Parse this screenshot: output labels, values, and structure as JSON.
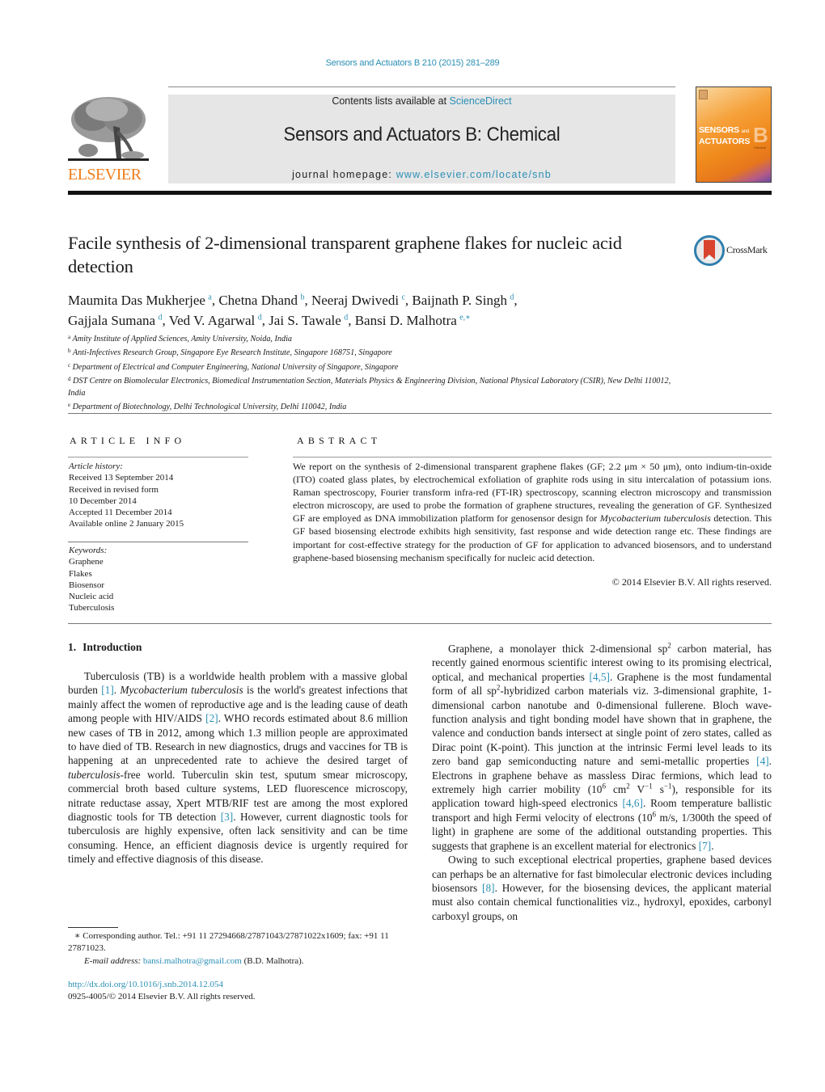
{
  "header": {
    "journal_ref": "Sensors and Actuators B 210 (2015) 281–289",
    "contents_prefix": "Contents lists available at ",
    "contents_link": "ScienceDirect",
    "journal_title": "Sensors and Actuators B: Chemical",
    "homepage_prefix": "journal homepage: ",
    "homepage_link": "www.elsevier.com/locate/snb",
    "publisher_logo_text": "ELSEVIER",
    "cover": {
      "title_line1": "SENSORS",
      "title_and": "and",
      "title_line2": "ACTUATORS",
      "letter": "B",
      "subtitle": "Chemical"
    },
    "colors": {
      "link": "#2b8fb4",
      "elsevier_orange": "#f07d1a",
      "masthead_bg": "#e6e6e6"
    }
  },
  "article": {
    "title": "Facile synthesis of 2-dimensional transparent graphene flakes for nucleic acid detection",
    "crossmark_label": "CrossMark",
    "authors": [
      {
        "name": "Maumita Das Mukherjee",
        "affil": "a",
        "sep": ", "
      },
      {
        "name": "Chetna Dhand",
        "affil": "b",
        "sep": ", "
      },
      {
        "name": "Neeraj Dwivedi",
        "affil": "c",
        "sep": ", "
      },
      {
        "name": "Baijnath P. Singh",
        "affil": "d",
        "sep": ","
      },
      {
        "name": "Gajjala Sumana",
        "affil": "d",
        "sep": ", "
      },
      {
        "name": "Ved V. Agarwal",
        "affil": "d",
        "sep": ", "
      },
      {
        "name": "Jai S. Tawale",
        "affil": "d",
        "sep": ", "
      },
      {
        "name": "Bansi D. Malhotra",
        "affil": "e,∗",
        "sep": ""
      }
    ],
    "affiliations": [
      {
        "key": "a",
        "text": "Amity Institute of Applied Sciences, Amity University, Noida, India"
      },
      {
        "key": "b",
        "text": "Anti-Infectives Research Group, Singapore Eye Research Institute, Singapore 168751, Singapore"
      },
      {
        "key": "c",
        "text": "Department of Electrical and Computer Engineering, National University of Singapore, Singapore"
      },
      {
        "key": "d",
        "text": "DST Centre on Biomolecular Electronics, Biomedical Instrumentation Section, Materials Physics & Engineering Division, National Physical Laboratory (CSIR), New Delhi 110012, India"
      },
      {
        "key": "e",
        "text": "Department of Biotechnology, Delhi Technological University, Delhi 110042, India"
      }
    ]
  },
  "article_info": {
    "heading": "ARTICLE INFO",
    "history_label": "Article history:",
    "history": [
      "Received 13 September 2014",
      "Received in revised form",
      "10 December 2014",
      "Accepted 11 December 2014",
      "Available online 2 January 2015"
    ],
    "keywords_label": "Keywords:",
    "keywords": [
      "Graphene",
      "Flakes",
      "Biosensor",
      "Nucleic acid",
      "Tuberculosis"
    ]
  },
  "abstract": {
    "heading": "ABSTRACT",
    "part1": "We report on the synthesis of 2-dimensional transparent graphene flakes (GF; 2.2 μm × 50 μm), onto indium-tin-oxide (ITO) coated glass plates, by electrochemical exfoliation of graphite rods using in situ intercalation of potassium ions. Raman spectroscopy, Fourier transform infra-red (FT-IR) spectroscopy, scanning electron microscopy and transmission electron microscopy, are used to probe the formation of graphene structures, revealing the generation of GF. Synthesized GF are employed as DNA immobilization platform for genosensor design for ",
    "italic": "Mycobacterium tuberculosis",
    "part2": " detection. This GF based biosensing electrode exhibits high sensitivity, fast response and wide detection range etc. These findings are important for cost-effective strategy for the production of GF for application to advanced biosensors, and to understand graphene-based biosensing mechanism specifically for nucleic acid detection.",
    "copyright": "© 2014 Elsevier B.V. All rights reserved."
  },
  "introduction": {
    "number": "1.",
    "heading": "Introduction",
    "p1": {
      "s1": "Tuberculosis (TB) is a worldwide health problem with a massive global burden ",
      "ref1": "[1]",
      "s2": ". ",
      "italic1": "Mycobacterium tuberculosis",
      "s3": " is the world's greatest infections that mainly affect the women of reproductive age and is the leading cause of death among people with HIV/AIDS ",
      "ref2": "[2]",
      "s4": ". WHO records estimated about 8.6 million new cases of TB in 2012, among which 1.3 million people are approximated to have died of TB. Research in new diagnostics, drugs and vaccines for TB is happening at an unprecedented rate to achieve the desired target of ",
      "italic2": "tuberculosis",
      "s5": "-free world. Tuberculin skin test, sputum smear microscopy, commercial broth based culture systems, LED fluorescence microscopy, nitrate reductase assay, Xpert MTB/RIF test are among the most explored diagnostic tools for TB detection ",
      "ref3": "[3]",
      "s6": ". However, current diagnostic tools for tuberculosis are highly expensive, often lack sensitivity and can be time consuming. Hence, an efficient diagnosis device is urgently required for timely and effective diagnosis of this disease."
    },
    "p2": {
      "s1": "Graphene, a monolayer thick 2-dimensional sp",
      "sup1": "2",
      "s2": " carbon material, has recently gained enormous scientific interest owing to its promising electrical, optical, and mechanical properties ",
      "ref1": "[4,5]",
      "s3": ". Graphene is the most fundamental form of all sp",
      "sup2": "2",
      "s4": "-hybridized carbon materials viz. 3-dimensional graphite, 1-dimensional carbon nanotube and 0-dimensional fullerene. Bloch wave-function analysis and tight bonding model have shown that in graphene, the valence and conduction bands intersect at single point of zero states, called as Dirac point (K-point). This junction at the intrinsic Fermi level leads to its zero band gap semiconducting nature and semi-metallic properties ",
      "ref2": "[4]",
      "s5": ". Electrons in graphene behave as massless Dirac fermions, which lead to extremely high carrier mobility (10",
      "sup3": "6",
      "s6": " cm",
      "sup4": "2",
      "s7": " V",
      "sup5": "−1",
      "s8": " s",
      "sup6": "−1",
      "s9": "), responsible for its application toward high-speed electronics ",
      "ref3": "[4,6]",
      "s10": ". Room temperature ballistic transport and high Fermi velocity of electrons (10",
      "sup7": "6",
      "s11": " m/s, 1/300th the speed of light) in graphene are some of the additional outstanding properties. This suggests that graphene is an excellent material for electronics ",
      "ref4": "[7]",
      "s12": "."
    },
    "p3": {
      "s1": "Owing to such exceptional electrical properties, graphene based devices can perhaps be an alternative for fast bimolecular electronic devices including biosensors ",
      "ref1": "[8]",
      "s2": ". However, for the biosensing devices, the applicant material must also contain chemical functionalities viz., hydroxyl, epoxides, carbonyl carboxyl groups, on"
    }
  },
  "footnotes": {
    "corresponding": "∗ Corresponding author. Tel.: +91 11 27294668/27871043/27871022x1609; fax: +91 11 27871023.",
    "email_label": "E-mail address: ",
    "email": "bansi.malhotra@gmail.com",
    "email_suffix": " (B.D. Malhotra).",
    "doi": "http://dx.doi.org/10.1016/j.snb.2014.12.054",
    "issn_copyright": "0925-4005/© 2014 Elsevier B.V. All rights reserved."
  }
}
